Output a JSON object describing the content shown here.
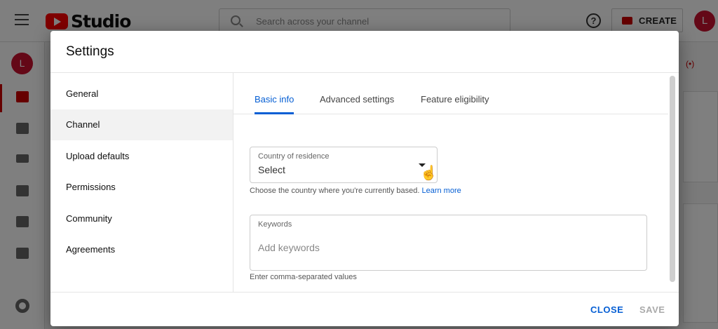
{
  "app": {
    "logo_text": "Studio",
    "search_placeholder": "Search across your channel",
    "help_glyph": "?",
    "create_label": "CREATE",
    "avatar_initial": "L"
  },
  "dialog": {
    "title": "Settings",
    "nav": [
      {
        "label": "General",
        "active": false
      },
      {
        "label": "Channel",
        "active": true
      },
      {
        "label": "Upload defaults",
        "active": false
      },
      {
        "label": "Permissions",
        "active": false
      },
      {
        "label": "Community",
        "active": false
      },
      {
        "label": "Agreements",
        "active": false
      }
    ],
    "tabs": [
      {
        "label": "Basic info",
        "active": true
      },
      {
        "label": "Advanced settings",
        "active": false
      },
      {
        "label": "Feature eligibility",
        "active": false
      }
    ],
    "country": {
      "label": "Country of residence",
      "value": "Select",
      "helper": "Choose the country where you're currently based.",
      "learn_more": "Learn more"
    },
    "keywords": {
      "label": "Keywords",
      "placeholder": "Add keywords",
      "helper": "Enter comma-separated values"
    },
    "footer": {
      "close_label": "CLOSE",
      "save_label": "SAVE"
    }
  },
  "colors": {
    "accent": "#065fd4",
    "brand_red": "#ff0000",
    "avatar": "#c8102e"
  }
}
